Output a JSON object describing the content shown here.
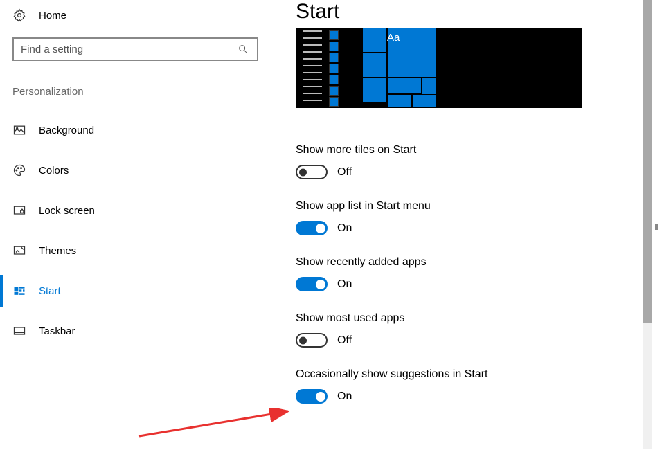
{
  "home": {
    "label": "Home"
  },
  "search": {
    "placeholder": "Find a setting"
  },
  "section": {
    "title": "Personalization"
  },
  "nav": {
    "items": [
      {
        "label": "Background"
      },
      {
        "label": "Colors"
      },
      {
        "label": "Lock screen"
      },
      {
        "label": "Themes"
      },
      {
        "label": "Start"
      },
      {
        "label": "Taskbar"
      }
    ]
  },
  "page": {
    "title": "Start",
    "preview_text": "Aa"
  },
  "settings": [
    {
      "label": "Show more tiles on Start",
      "state": "Off",
      "on": false
    },
    {
      "label": "Show app list in Start menu",
      "state": "On",
      "on": true
    },
    {
      "label": "Show recently added apps",
      "state": "On",
      "on": true
    },
    {
      "label": "Show most used apps",
      "state": "Off",
      "on": false
    },
    {
      "label": "Occasionally show suggestions in Start",
      "state": "On",
      "on": true
    }
  ]
}
